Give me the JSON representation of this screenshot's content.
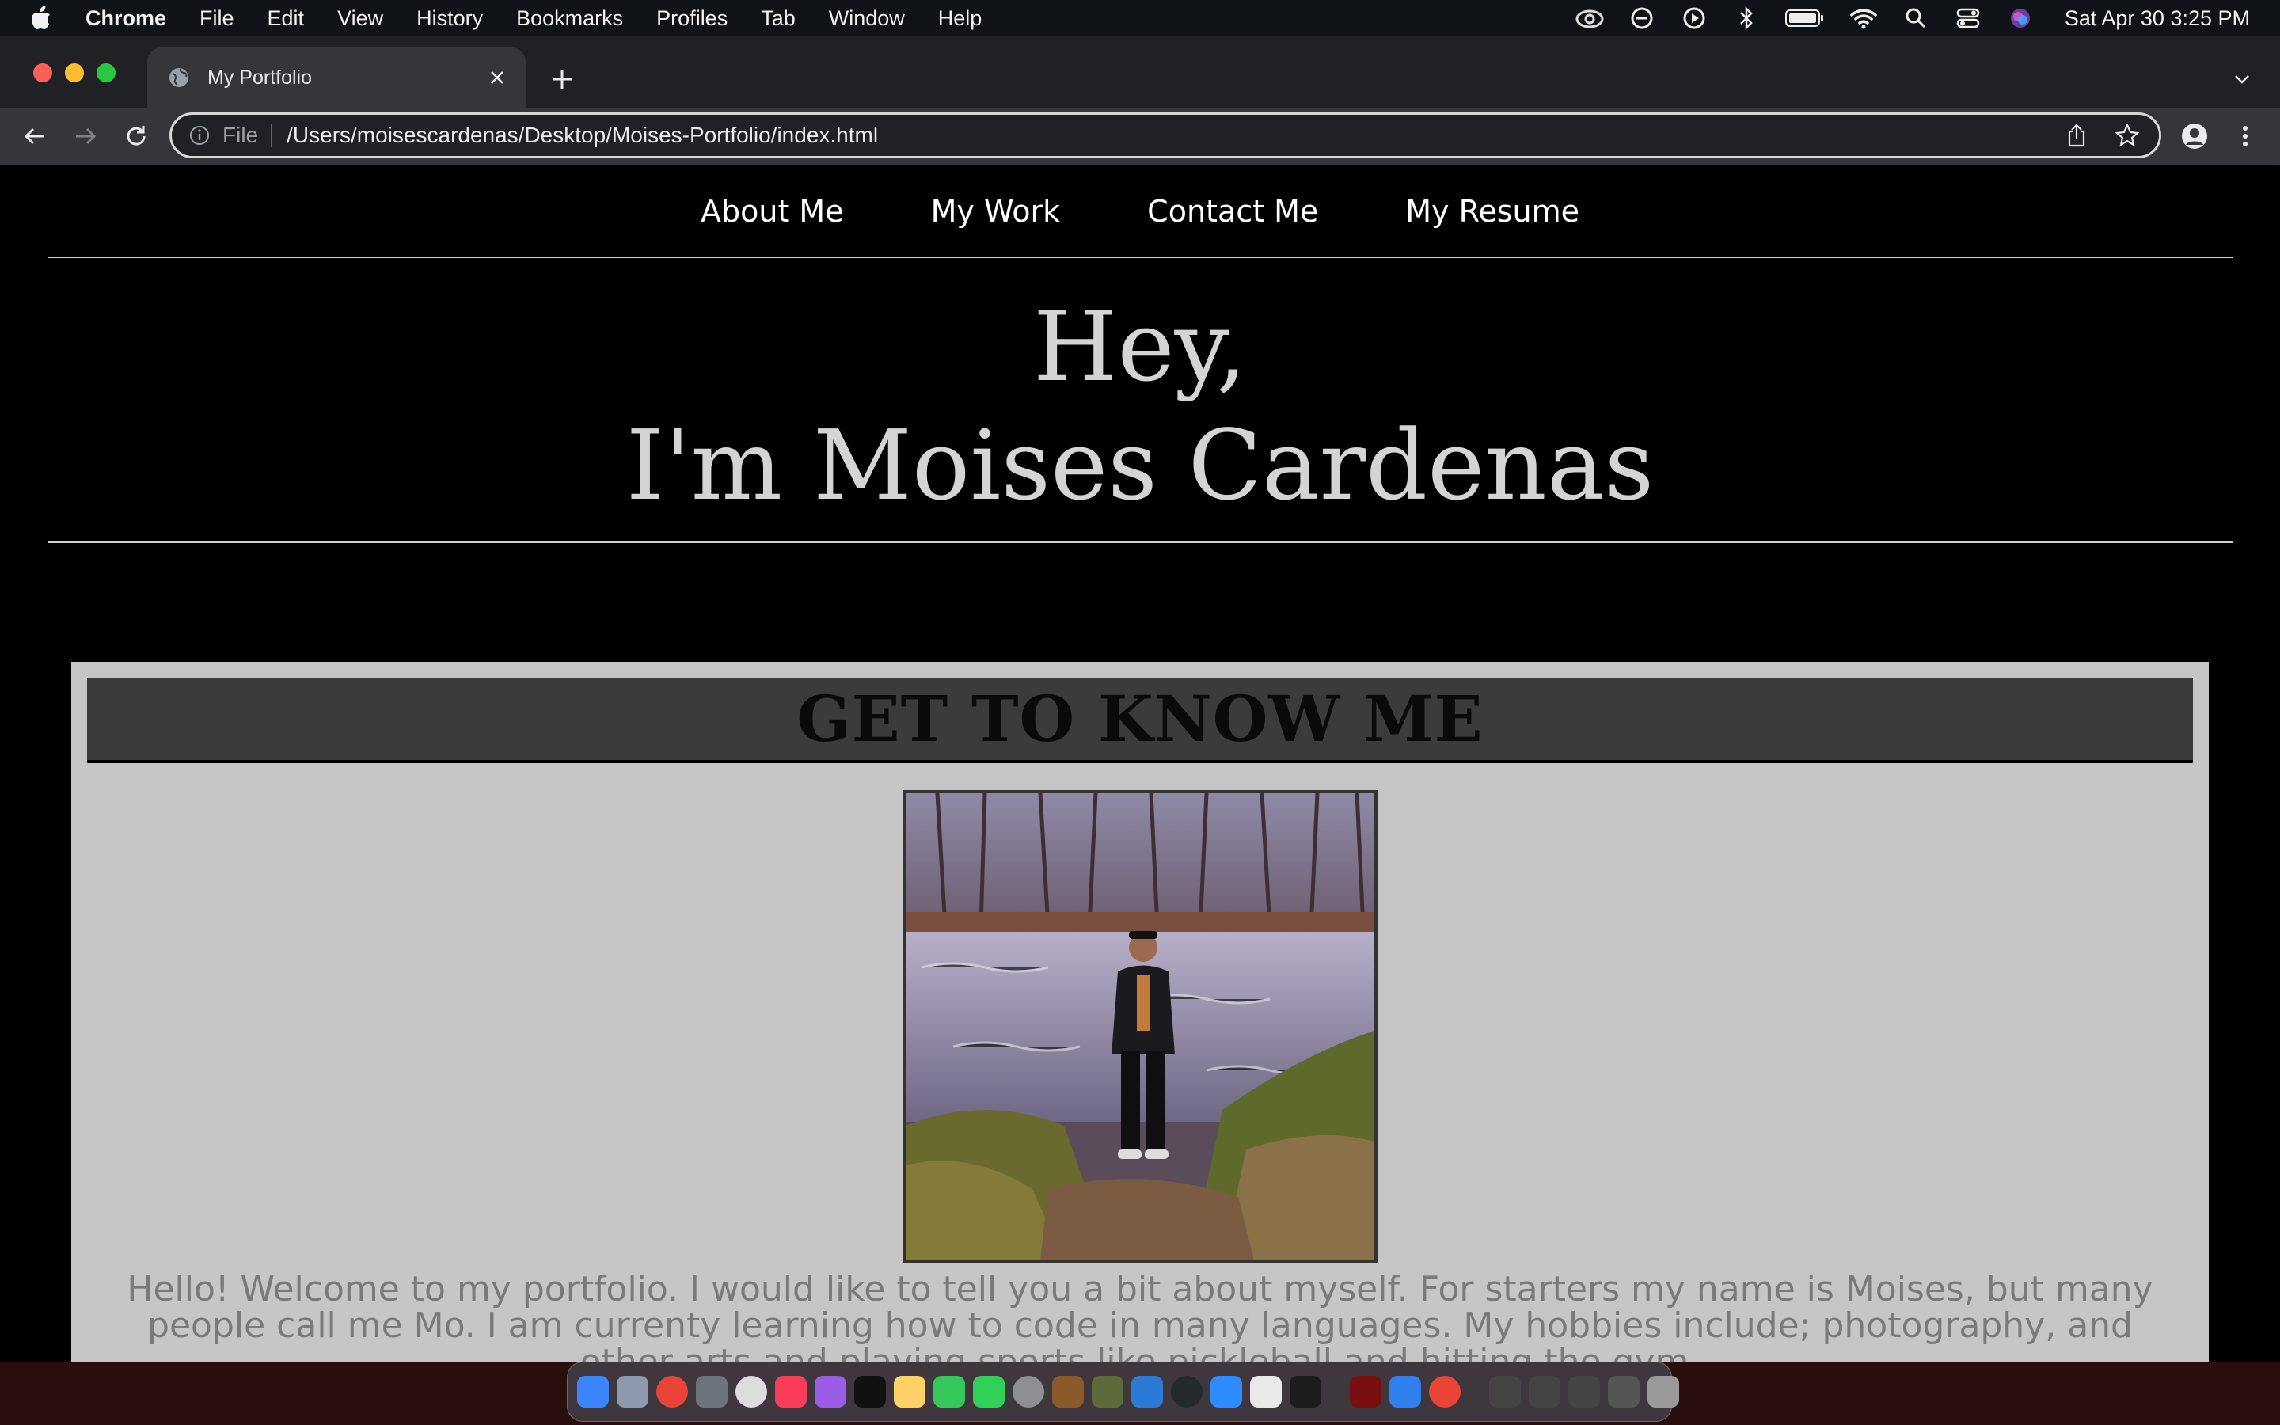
{
  "menubar": {
    "app_name": "Chrome",
    "items": [
      "File",
      "Edit",
      "View",
      "History",
      "Bookmarks",
      "Profiles",
      "Tab",
      "Window",
      "Help"
    ],
    "clock": "Sat Apr 30  3:25 PM"
  },
  "browser": {
    "tab_title": "My Portfolio",
    "address_scheme": "File",
    "address_url": "/Users/moisescardenas/Desktop/Moises-Portfolio/index.html"
  },
  "site": {
    "nav": [
      "About Me",
      "My Work",
      "Contact Me",
      "My Resume"
    ],
    "hero_line1": "Hey,",
    "hero_line2": "I'm Moises Cardenas",
    "section_title": "GET TO KNOW ME",
    "about_text": "Hello! Welcome to my portfolio. I would like to tell you a bit about myself. For starters my name is Moises, but many people call me Mo. I am currenty learning how to code in many languages. My hobbies include; photography, and other arts and playing sports like pickleball and hitting the gym."
  },
  "colors": {
    "page_bg": "#000000",
    "about_bg": "#c6c6c6",
    "section_header_bg": "#3b3b3b",
    "hero_text": "#d4d4d4"
  }
}
